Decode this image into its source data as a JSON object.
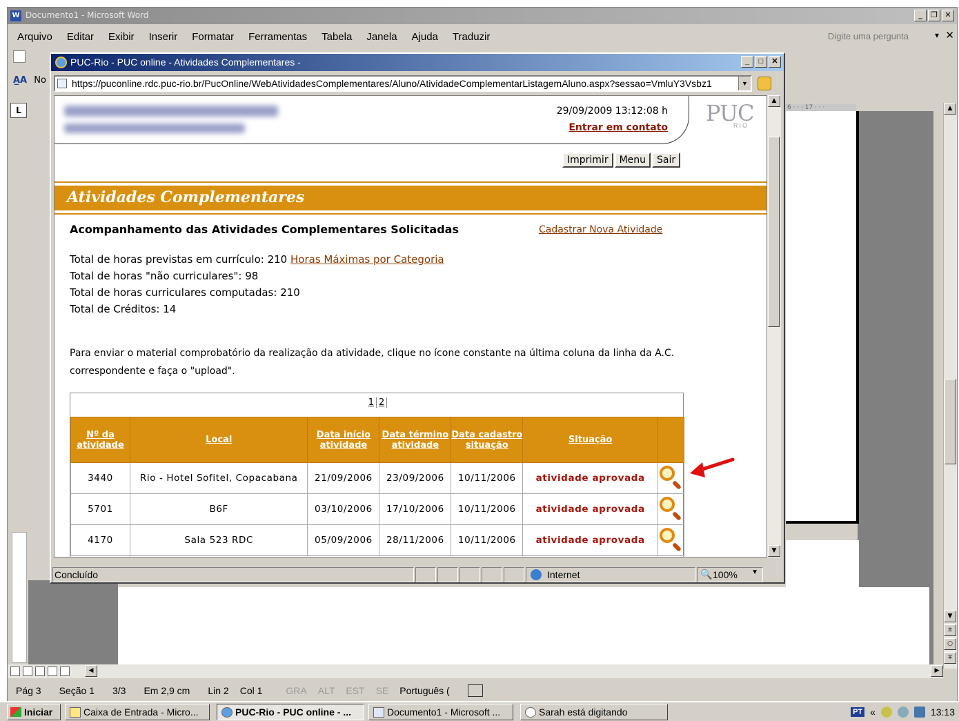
{
  "word": {
    "title": "Documento1 - Microsoft Word",
    "menu": [
      "Arquivo",
      "Editar",
      "Exibir",
      "Inserir",
      "Formatar",
      "Ferramentas",
      "Tabela",
      "Janela",
      "Ajuda",
      "Traduzir"
    ],
    "help_placeholder": "Digite uma pergunta",
    "toolbar_label": "A̲A",
    "toolbar_trunc": "No",
    "ruler_fragment": "6 · · · 17 · · ·",
    "status": {
      "page": "Pág 3",
      "section": "Seção 1",
      "pages": "3/3",
      "at": "Em 2,9 cm",
      "line": "Lin 2",
      "col": "Col 1",
      "flags": [
        "GRA",
        "ALT",
        "EST",
        "SE"
      ],
      "language": "Português ("
    }
  },
  "ie": {
    "title": "PUC-Rio - PUC online - Atividades Complementares -",
    "url": "https://puconline.rdc.puc-rio.br/PucOnline/WebAtividadesComplementares/Aluno/AtividadeComplementarListagemAluno.aspx?sessao=VmluY3Vsbz1",
    "status_text": "Concluído",
    "zone": "Internet",
    "zoom": "100%"
  },
  "page": {
    "datetime": "29/09/2009 13:12:08 h",
    "contact_link": "Entrar em contato",
    "logo_text": "PUC",
    "logo_sub": "RIO",
    "buttons": {
      "print": "Imprimir",
      "menu": "Menu",
      "exit": "Sair"
    },
    "banner": "Atividades Complementares",
    "section_title": "Acompanhamento das Atividades Complementares Solicitadas",
    "new_activity_link": "Cadastrar Nova Atividade",
    "totals": {
      "planned_label": "Total de horas previstas em currículo:",
      "planned_value": "210",
      "max_link": "Horas Máximas por Categoria",
      "non_curricular_label": "Total de horas \"não curriculares\":",
      "non_curricular_value": "98",
      "curricular_label": "Total de horas curriculares computadas:",
      "curricular_value": "210",
      "credits_label": "Total de Créditos:",
      "credits_value": "14"
    },
    "instructions": "Para enviar o material comprobatório da realização da atividade, clique no ícone constante na última coluna da linha da A.C. correspondente e faça o \"upload\".",
    "pager": [
      "1",
      "2"
    ],
    "table": {
      "headers": [
        "Nº da atividade",
        "Local",
        "Data início atividade",
        "Data término atividade",
        "Data cadastro situação",
        "Situação"
      ],
      "rows": [
        {
          "num": "3440",
          "local": "Rio - Hotel Sofitel, Copacabana",
          "inicio": "21/09/2006",
          "termino": "23/09/2006",
          "cadastro": "10/11/2006",
          "situacao": "atividade aprovada"
        },
        {
          "num": "5701",
          "local": "B6F",
          "inicio": "03/10/2006",
          "termino": "17/10/2006",
          "cadastro": "10/11/2006",
          "situacao": "atividade aprovada"
        },
        {
          "num": "4170",
          "local": "Sala 523 RDC",
          "inicio": "05/09/2006",
          "termino": "28/11/2006",
          "cadastro": "10/11/2006",
          "situacao": "atividade aprovada"
        }
      ]
    }
  },
  "taskbar": {
    "start": "Iniciar",
    "tasks": [
      "Caixa de Entrada - Micro...",
      "PUC-Rio - PUC online - ...",
      "Documento1 - Microsoft ...",
      "Sarah está digitando"
    ],
    "lang": "PT",
    "clock": "13:13"
  },
  "colors": {
    "accent_orange": "#d9900f",
    "status_red": "#a3160b",
    "link_brown": "#8a3a00"
  }
}
